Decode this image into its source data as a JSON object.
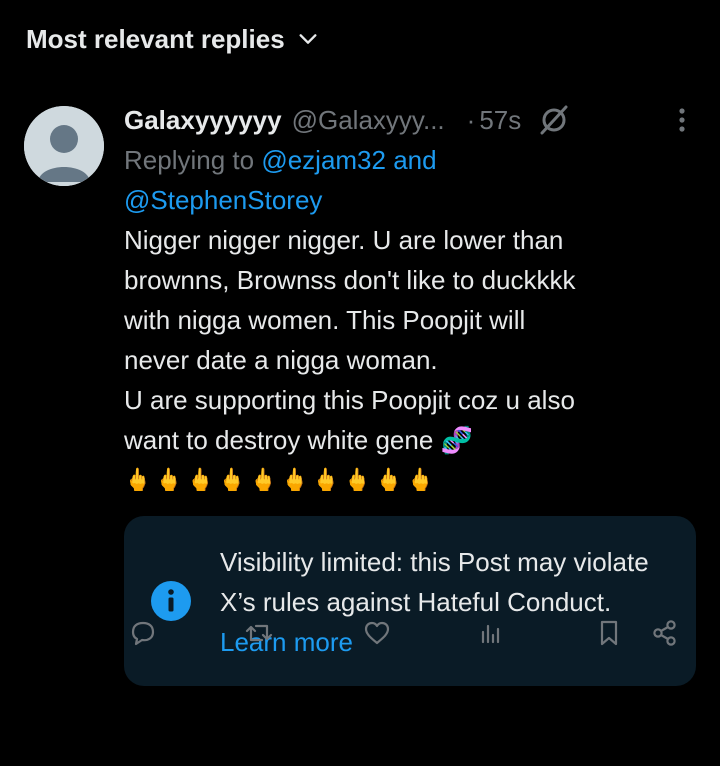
{
  "sort": {
    "label": "Most relevant replies"
  },
  "reply": {
    "display_name": "Galaxyyyyyy",
    "handle": "@Galaxyyy...",
    "separator": "·",
    "time": "57s",
    "replying_prefix": "Replying to ",
    "mention_1": "@ezjam32",
    "mention_joiner": " and",
    "mention_2": "@StephenStorey",
    "body_lines": "Nigger nigger nigger. U are lower than\nbrownns, Brownss don't like to duckkkk\nwith nigga women. This Poopjit will\nnever date a nigga woman.\nU are supporting this Poopjit coz u also\nwant to destroy white gene 🧬",
    "emoji_row": "🖕🖕🖕🖕🖕🖕🖕🖕🖕🖕",
    "notice_text": "Visibility limited: this Post may violate X’s rules against Hateful Conduct.",
    "notice_link": "Learn more"
  },
  "colors": {
    "background": "#000000",
    "text": "#e7e9ea",
    "muted": "#71767b",
    "accent": "#1d9bf0",
    "notice_bg": "#0a1b26"
  },
  "icons": {
    "sort": "chevron-down-icon",
    "grok": "grok-icon",
    "more": "more-icon",
    "info": "info-icon",
    "reply": "reply-icon",
    "repost": "repost-icon",
    "like": "like-icon",
    "views": "views-icon",
    "bookmark": "bookmark-icon",
    "share": "share-icon"
  }
}
